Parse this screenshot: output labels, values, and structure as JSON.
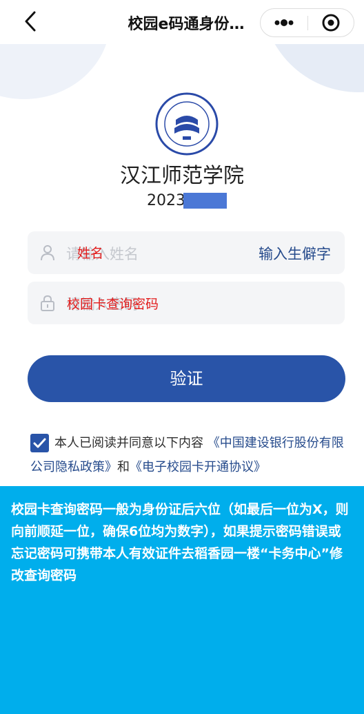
{
  "nav": {
    "title": "校园e码通身份…",
    "back_icon": "chevron-left-icon",
    "more_icon": "more-dots-icon",
    "close_icon": "target-close-icon"
  },
  "hero": {
    "logo_icon": "university-seal-icon",
    "logo_text": "汉江师范学院",
    "school_name": "汉江师范学院",
    "student_id_visible": "2023",
    "mask_color": "#4b78d6"
  },
  "form": {
    "name_placeholder": "请输入姓名",
    "name_overlay": "姓名",
    "rare_char_link": "输入生僻字",
    "password_placeholder": "请输入密码",
    "password_overlay": "校园卡查询密码",
    "user_icon": "user-icon",
    "lock_icon": "lock-icon"
  },
  "verify_button": "验证",
  "agreement": {
    "checked": true,
    "text": "本人已阅读并同意以下内容",
    "privacy_link": "《中国建设银行股份有限公司隐私政策》",
    "and": "和",
    "card_link": "《电子校园卡开通协议》"
  },
  "notice": {
    "text": "校园卡查询密码一般为身份证后六位（如最后一位为X，则向前顺延一位，确保6位均为数字），如果提示密码错误或忘记密码可携带本人有效证件去稻香园一楼“卡务中心”修改查询密码"
  },
  "colors": {
    "primary": "#2954a8",
    "link": "#264b8c",
    "notice_bg": "#00aeec",
    "overlay_red": "#e21b1b"
  }
}
